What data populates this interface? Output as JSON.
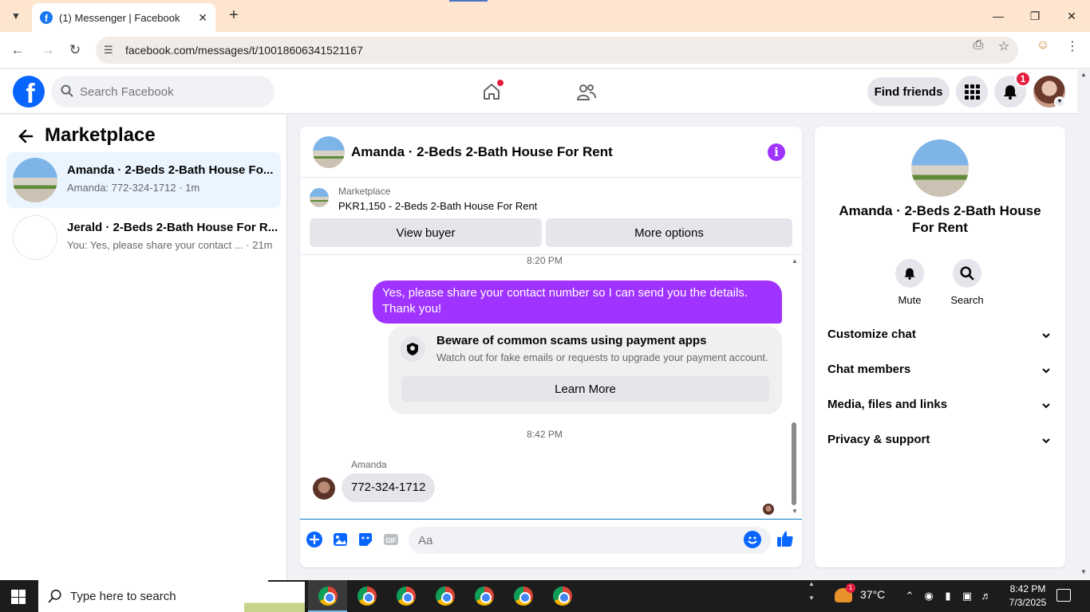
{
  "browser": {
    "tab_title": "(1) Messenger | Facebook",
    "url": "facebook.com/messages/t/10018606341521167"
  },
  "fb": {
    "search_placeholder": "Search Facebook",
    "find_friends": "Find friends",
    "notif_count": "1"
  },
  "sidebar": {
    "title": "Marketplace",
    "conversations": [
      {
        "name": "Amanda · 2-Beds 2-Bath House Fo...",
        "snippet": "Amanda: 772-324-1712 · 1m"
      },
      {
        "name": "Jerald · 2-Beds 2-Bath House For R...",
        "snippet": "You: Yes, please share your contact ...  · 21m"
      }
    ]
  },
  "chat": {
    "title": "Amanda · 2-Beds 2-Bath House For Rent",
    "marketplace_label": "Marketplace",
    "listing": "PKR1,150 - 2-Beds 2-Bath House For Rent",
    "view_buyer": "View buyer",
    "more_options": "More options",
    "time1": "8:20 PM",
    "outgoing": "Yes, please share your contact number so I can send you the details. Thank you!",
    "scam_title": "Beware of common scams using payment apps",
    "scam_desc": "Watch out for fake emails or requests to upgrade your payment account.",
    "learn_more": "Learn More",
    "time2": "8:42 PM",
    "sender": "Amanda",
    "incoming": "772-324-1712",
    "composer_placeholder": "Aa"
  },
  "panel": {
    "name": "Amanda · 2-Beds 2-Bath House For Rent",
    "mute": "Mute",
    "search": "Search",
    "rows": [
      "Customize chat",
      "Chat members",
      "Media, files and links",
      "Privacy & support"
    ]
  },
  "taskbar": {
    "search_text": "Type here to search",
    "temperature": "37°C",
    "weather_badge": "1",
    "time": "8:42 PM",
    "date": "7/3/2025"
  },
  "colors": {
    "fb_blue": "#0866ff",
    "messenger_purple": "#a033ff",
    "notification_red": "#e41e3f"
  }
}
